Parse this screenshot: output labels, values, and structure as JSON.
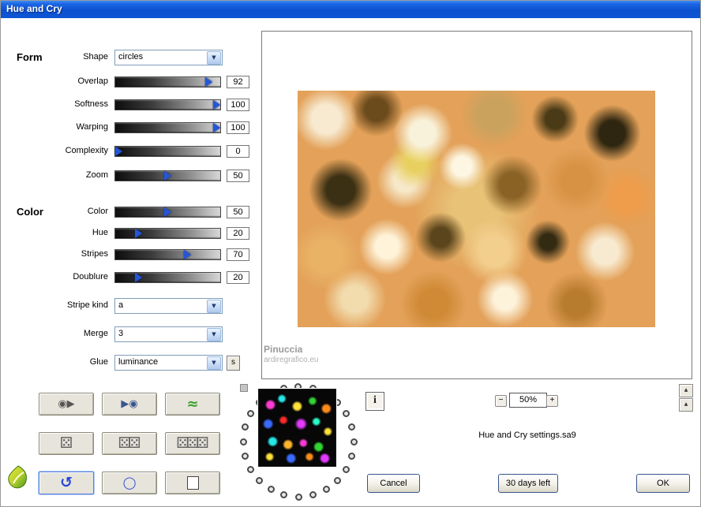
{
  "window": {
    "title": "Hue and Cry"
  },
  "colors": {
    "titlebar_top": "#3b8bf5",
    "titlebar_bottom": "#0d55d4",
    "slider_marker": "#2456d6",
    "field_border": "#7f9db9"
  },
  "icons": {
    "combo_arrow": "▼"
  },
  "sections": {
    "form": "Form",
    "color": "Color"
  },
  "dropdowns": {
    "shape": {
      "label": "Shape",
      "value": "circles"
    },
    "stripe_kind": {
      "label": "Stripe kind",
      "value": "a"
    },
    "merge": {
      "label": "Merge",
      "value": "3"
    },
    "glue": {
      "label": "Glue",
      "value": "luminance",
      "side_button": "s"
    }
  },
  "sliders": [
    {
      "id": "overlap",
      "label": "Overlap",
      "value": 92
    },
    {
      "id": "softness",
      "label": "Softness",
      "value": 100
    },
    {
      "id": "warping",
      "label": "Warping",
      "value": 100
    },
    {
      "id": "complexity",
      "label": "Complexity",
      "value": 0
    },
    {
      "id": "zoom",
      "label": "Zoom",
      "value": 50
    },
    {
      "id": "color",
      "label": "Color",
      "value": 50
    },
    {
      "id": "hue",
      "label": "Hue",
      "value": 20
    },
    {
      "id": "stripes",
      "label": "Stripes",
      "value": 70
    },
    {
      "id": "doublure",
      "label": "Doublure",
      "value": 20
    }
  ],
  "tools": [
    {
      "name": "disc-play-icon",
      "glyph": "◉▶"
    },
    {
      "name": "play-disc-icon",
      "glyph": "▶◉"
    },
    {
      "name": "wave-icon",
      "glyph": "≈"
    },
    {
      "name": "die-one-icon",
      "glyph": "⚄"
    },
    {
      "name": "dice-two-icon",
      "glyph": "⚄⚄"
    },
    {
      "name": "dice-three-icon",
      "glyph": "⚄⚄⚄"
    },
    {
      "name": "undo-icon",
      "glyph": "↺"
    },
    {
      "name": "ring-icon",
      "glyph": "◯"
    },
    {
      "name": "copy-icon",
      "glyph": ""
    }
  ],
  "preview": {
    "watermark_name": "Pinuccia",
    "watermark_site": "ardiregrafico.eu"
  },
  "footer": {
    "info_button": "i",
    "zoom_out": "−",
    "zoom_level": "50%",
    "zoom_in": "+",
    "spin_buttons": [
      "▲",
      "▲"
    ],
    "settings_name": "Hue and Cry settings.sa9",
    "cancel_button": "Cancel",
    "trial_button": "30 days left",
    "ok_button": "OK"
  }
}
